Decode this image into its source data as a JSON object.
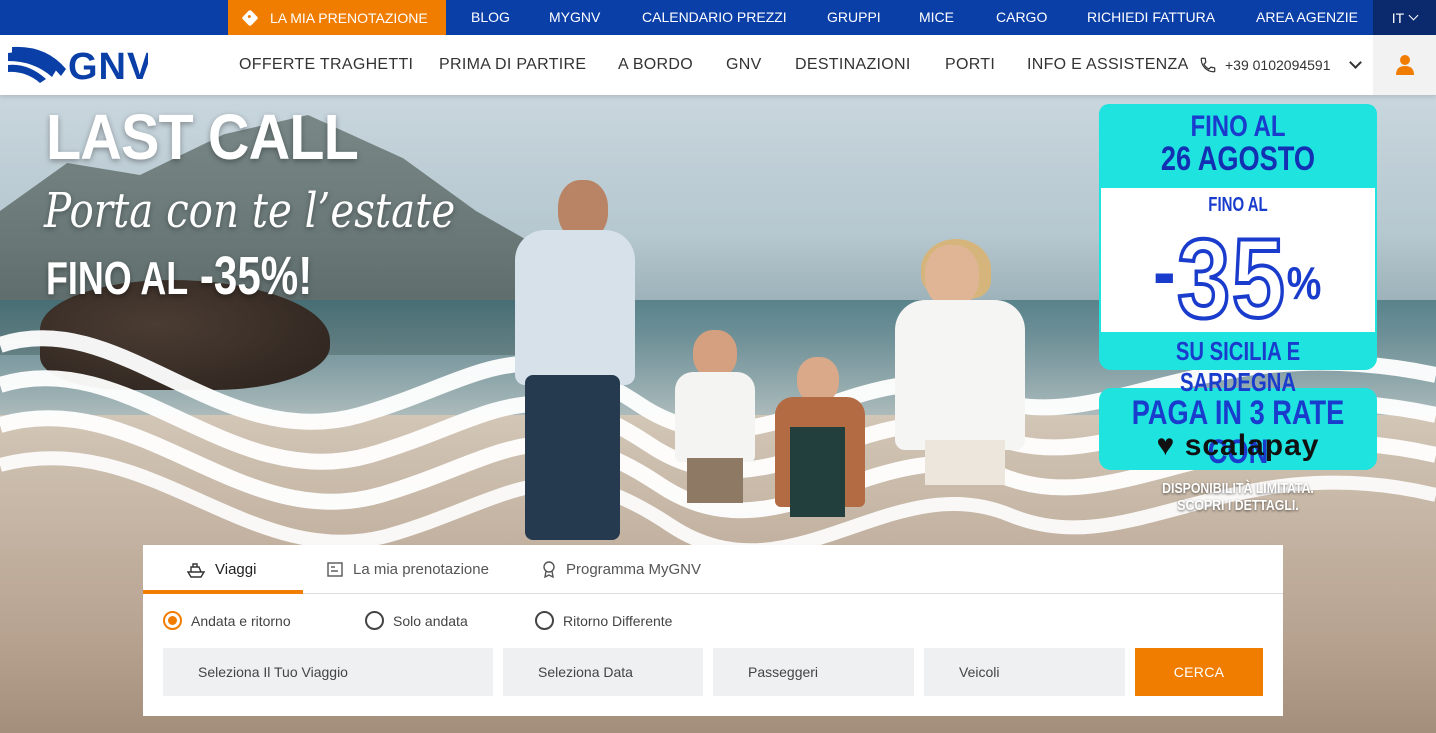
{
  "topbar": {
    "booking_label": "LA MIA PRENOTAZIONE",
    "links": [
      "BLOG",
      "MYGNV",
      "CALENDARIO PREZZI",
      "GRUPPI",
      "MICE",
      "CARGO",
      "RICHIEDI FATTURA",
      "AREA AGENZIE"
    ],
    "language": "IT"
  },
  "nav": {
    "logo_text": "GNV",
    "items": [
      "OFFERTE TRAGHETTI",
      "PRIMA DI PARTIRE",
      "A BORDO",
      "GNV",
      "DESTINAZIONI",
      "PORTI",
      "INFO E ASSISTENZA"
    ],
    "phone": "+39 0102094591"
  },
  "hero": {
    "title": "LAST CALL",
    "subtitle": "Porta con te l’estate",
    "offer_prefix": "FINO AL",
    "offer_value": "-35%!"
  },
  "promo": {
    "until_label": "FINO AL",
    "until_date": "26 AGOSTO",
    "discount_prefix": "FINO AL",
    "discount_minus": "-",
    "discount_value": "35",
    "discount_sign": "%",
    "routes": "SU SICILIA E SARDEGNA",
    "installments": "PAGA IN 3 RATE CON",
    "partner": "scalapay",
    "disclaimer_line1": "DISPONIBILITÀ LIMITATA.",
    "disclaimer_line2": "SCOPRI I DETTAGLI."
  },
  "widget": {
    "tabs": [
      "Viaggi",
      "La mia prenotazione",
      "Programma MyGNV"
    ],
    "active_tab": "Viaggi",
    "trip_types": [
      "Andata e ritorno",
      "Solo andata",
      "Ritorno Differente"
    ],
    "selected_trip_type": "Andata e ritorno",
    "fields": {
      "trip": "Seleziona Il Tuo Viaggio",
      "date": "Seleziona Data",
      "passengers": "Passeggeri",
      "vehicles": "Veicoli"
    },
    "search_label": "CERCA"
  },
  "colors": {
    "brand_blue": "#0a3fa8",
    "accent_orange": "#f07d00",
    "promo_cyan": "#1ee3df",
    "promo_blue": "#1a3ccd"
  }
}
